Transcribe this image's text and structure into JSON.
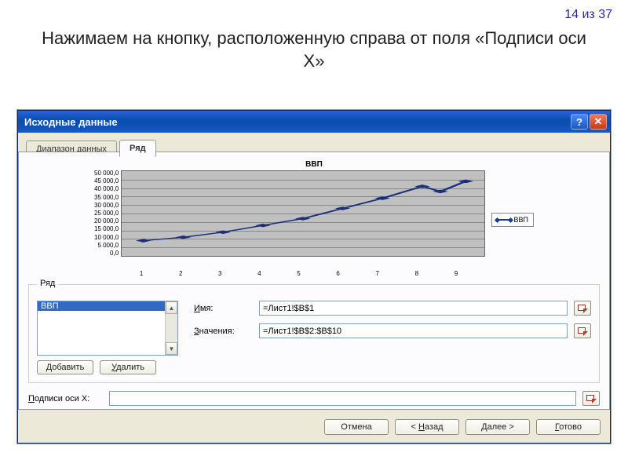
{
  "page_counter": "14 из 37",
  "instruction": "Нажимаем на кнопку, расположенную справа от поля «Подписи оси X»",
  "dialog": {
    "title": "Исходные данные",
    "tabs": [
      "Диапазон данных",
      "Ряд"
    ],
    "active_tab": 1,
    "series_fs_label": "Ряд",
    "series_list": [
      "ВВП"
    ],
    "add_btn": "Добавить",
    "remove_btn": "Удалить",
    "name_label": "Имя:",
    "name_value": "=Лист1!$B$1",
    "values_label": "Значения:",
    "values_value": "=Лист1!$B$2:$B$10",
    "xlabels_label": "Подписи оси X:",
    "xlabels_value": "",
    "buttons": {
      "cancel": "Отмена",
      "back": "< Назад",
      "next": "Далее >",
      "finish": "Готово"
    }
  },
  "chart_data": {
    "type": "line",
    "title": "ВВП",
    "legend": "ВВП",
    "x": [
      1,
      2,
      3,
      4,
      5,
      6,
      7,
      8,
      9
    ],
    "values": [
      9000,
      11000,
      14000,
      18000,
      22000,
      28000,
      34000,
      41000,
      38000,
      44000
    ],
    "ylim": [
      0,
      50000
    ],
    "yticks": [
      "50 000,0",
      "45 000,0",
      "40 000,0",
      "35 000,0",
      "30 000,0",
      "25 000,0",
      "20 000,0",
      "15 000,0",
      "10 000,0",
      "5 000,0",
      "0,0"
    ],
    "xlabel": "",
    "ylabel": ""
  }
}
